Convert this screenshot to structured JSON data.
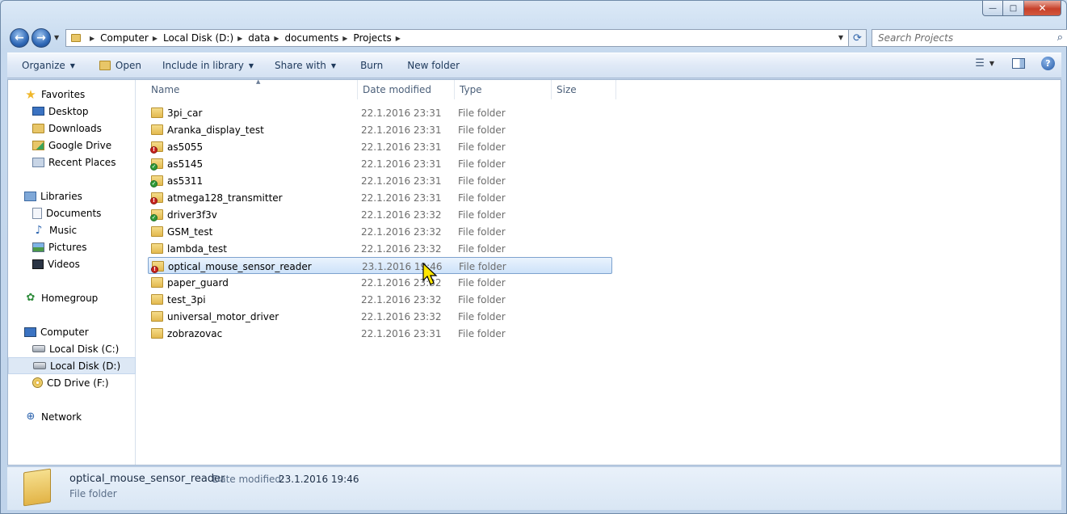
{
  "window": {
    "minimize_glyph": "—",
    "maximize_glyph": "□",
    "close_glyph": "✕"
  },
  "nav": {
    "back_glyph": "←",
    "forward_glyph": "→",
    "breadcrumbs": [
      "Computer",
      "Local Disk (D:)",
      "data",
      "documents",
      "Projects"
    ],
    "search_placeholder": "Search Projects"
  },
  "toolbar": {
    "organize": "Organize",
    "open": "Open",
    "include_in_library": "Include in library",
    "share_with": "Share with",
    "burn": "Burn",
    "new_folder": "New folder"
  },
  "sidebar": {
    "favorites": "Favorites",
    "favorites_items": [
      "Desktop",
      "Downloads",
      "Google Drive",
      "Recent Places"
    ],
    "libraries": "Libraries",
    "libraries_items": [
      "Documents",
      "Music",
      "Pictures",
      "Videos"
    ],
    "homegroup": "Homegroup",
    "computer": "Computer",
    "computer_items": [
      "Local Disk (C:)",
      "Local Disk (D:)",
      "CD Drive (F:)"
    ],
    "network": "Network"
  },
  "columns": {
    "name": "Name",
    "date_modified": "Date modified",
    "type": "Type",
    "size": "Size"
  },
  "files": [
    {
      "name": "3pi_car",
      "date": "22.1.2016 23:31",
      "type": "File folder",
      "overlay": "none"
    },
    {
      "name": "Aranka_display_test",
      "date": "22.1.2016 23:31",
      "type": "File folder",
      "overlay": "none"
    },
    {
      "name": "as5055",
      "date": "22.1.2016 23:31",
      "type": "File folder",
      "overlay": "error"
    },
    {
      "name": "as5145",
      "date": "22.1.2016 23:31",
      "type": "File folder",
      "overlay": "ok"
    },
    {
      "name": "as5311",
      "date": "22.1.2016 23:31",
      "type": "File folder",
      "overlay": "ok"
    },
    {
      "name": "atmega128_transmitter",
      "date": "22.1.2016 23:31",
      "type": "File folder",
      "overlay": "error"
    },
    {
      "name": "driver3f3v",
      "date": "22.1.2016 23:32",
      "type": "File folder",
      "overlay": "ok"
    },
    {
      "name": "GSM_test",
      "date": "22.1.2016 23:32",
      "type": "File folder",
      "overlay": "none"
    },
    {
      "name": "lambda_test",
      "date": "22.1.2016 23:32",
      "type": "File folder",
      "overlay": "none"
    },
    {
      "name": "optical_mouse_sensor_reader",
      "date": "23.1.2016 19:46",
      "type": "File folder",
      "overlay": "error"
    },
    {
      "name": "paper_guard",
      "date": "22.1.2016 23:32",
      "type": "File folder",
      "overlay": "none"
    },
    {
      "name": "test_3pi",
      "date": "22.1.2016 23:32",
      "type": "File folder",
      "overlay": "none"
    },
    {
      "name": "universal_motor_driver",
      "date": "22.1.2016 23:32",
      "type": "File folder",
      "overlay": "none"
    },
    {
      "name": "zobrazovac",
      "date": "22.1.2016 23:31",
      "type": "File folder",
      "overlay": "none"
    }
  ],
  "selected_index": 9,
  "details": {
    "name": "optical_mouse_sensor_reader",
    "date_label": "Date modified:",
    "date_value": "23.1.2016 19:46",
    "type": "File folder"
  },
  "colors": {
    "ok_overlay": "#2f9a37",
    "error_overlay": "#c9221c",
    "selection": "#cde2f9"
  }
}
